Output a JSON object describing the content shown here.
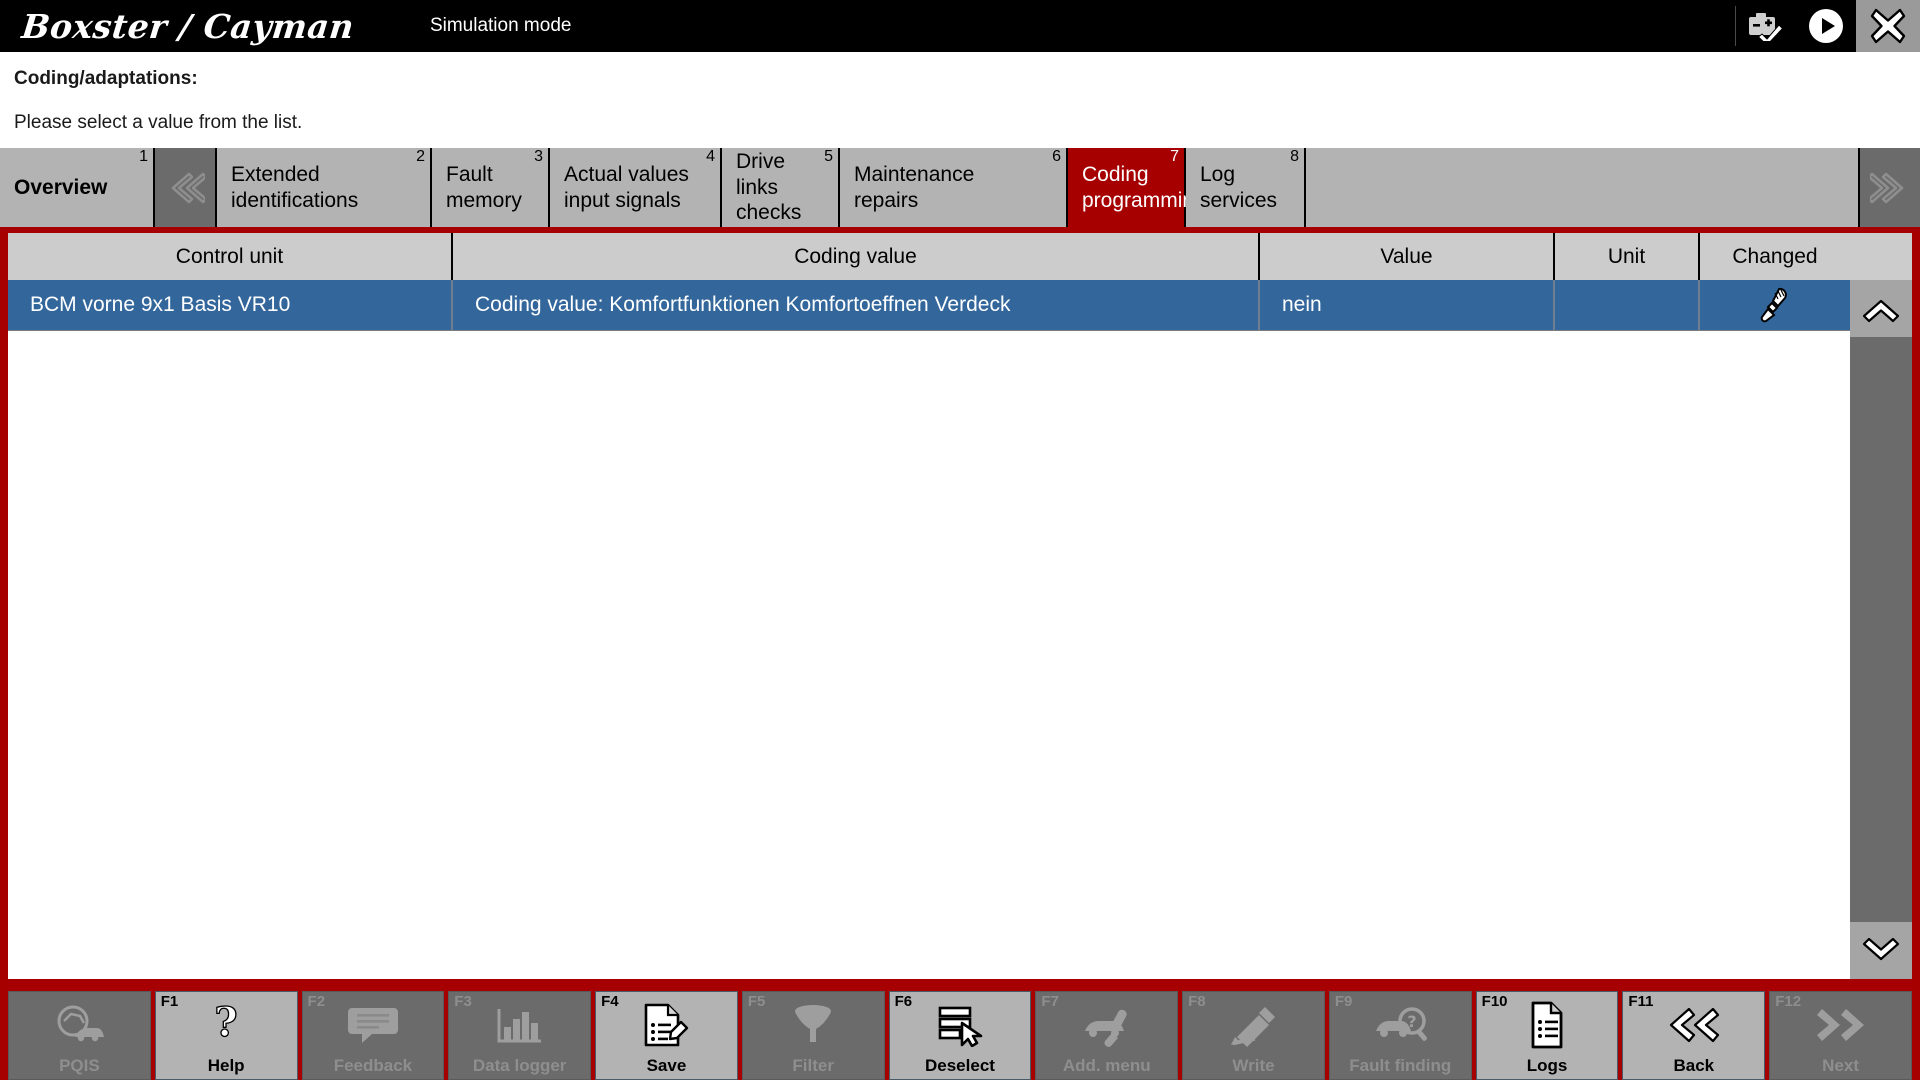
{
  "titlebar": {
    "brand": "Boxster / Cayman",
    "mode": "Simulation mode",
    "icons": [
      {
        "name": "battery-check-icon",
        "label": "Battery status OK"
      },
      {
        "name": "play-icon",
        "label": "Start"
      },
      {
        "name": "close-icon",
        "label": "Close"
      }
    ]
  },
  "header": {
    "title": "Coding/adaptations:",
    "instruction": "Please select a value from the list."
  },
  "tabs": {
    "prev_arrow": "chevron-left-icon",
    "next_arrow": "chevron-right-icon",
    "items": [
      {
        "num": "1",
        "label": "Overview",
        "active": false,
        "bold": true
      },
      {
        "num": "2",
        "label": "Extended\nidentifications",
        "active": false,
        "bold": false
      },
      {
        "num": "3",
        "label": "Fault memory",
        "active": false,
        "bold": false
      },
      {
        "num": "4",
        "label": "Actual values\ninput signals",
        "active": false,
        "bold": false
      },
      {
        "num": "5",
        "label": "Drive links\nchecks",
        "active": false,
        "bold": false
      },
      {
        "num": "6",
        "label": "Maintenance\nrepairs",
        "active": false,
        "bold": false
      },
      {
        "num": "7",
        "label": "Coding\nprogramming",
        "active": true,
        "bold": false
      },
      {
        "num": "8",
        "label": "Log services",
        "active": false,
        "bold": false
      }
    ]
  },
  "table": {
    "columns": [
      {
        "key": "control_unit",
        "label": "Control unit"
      },
      {
        "key": "coding_value",
        "label": "Coding value"
      },
      {
        "key": "value",
        "label": "Value"
      },
      {
        "key": "unit",
        "label": "Unit"
      },
      {
        "key": "changed",
        "label": "Changed"
      }
    ],
    "rows": [
      {
        "selected": true,
        "control_unit": "BCM vorne 9x1 Basis VR10",
        "coding_value": "Coding value: Komfortfunktionen Komfortoeffnen Verdeck",
        "value": "nein",
        "unit": "",
        "changed_icon": "screwdriver-icon"
      }
    ]
  },
  "scrollbar": {
    "up_icon": "chevron-up-icon",
    "down_icon": "chevron-down-icon"
  },
  "function_bar": [
    {
      "fkey": "",
      "label": "PQIS",
      "icon": "pqis-icon",
      "enabled": false
    },
    {
      "fkey": "F1",
      "label": "Help",
      "icon": "question-mark-icon",
      "enabled": true
    },
    {
      "fkey": "F2",
      "label": "Feedback",
      "icon": "speech-bubble-icon",
      "enabled": false
    },
    {
      "fkey": "F3",
      "label": "Data logger",
      "icon": "bar-chart-icon",
      "enabled": false
    },
    {
      "fkey": "F4",
      "label": "Save",
      "icon": "save-document-icon",
      "enabled": true
    },
    {
      "fkey": "F5",
      "label": "Filter",
      "icon": "funnel-icon",
      "enabled": false
    },
    {
      "fkey": "F6",
      "label": "Deselect",
      "icon": "deselect-icon",
      "enabled": true
    },
    {
      "fkey": "F7",
      "label": "Add. menu",
      "icon": "car-tool-icon",
      "enabled": false
    },
    {
      "fkey": "F8",
      "label": "Write",
      "icon": "write-icon",
      "enabled": false
    },
    {
      "fkey": "F9",
      "label": "Fault finding",
      "icon": "car-search-icon",
      "enabled": false
    },
    {
      "fkey": "F10",
      "label": "Logs",
      "icon": "document-list-icon",
      "enabled": true
    },
    {
      "fkey": "F11",
      "label": "Back",
      "icon": "double-chevron-left-icon",
      "enabled": true
    },
    {
      "fkey": "F12",
      "label": "Next",
      "icon": "double-chevron-right-icon",
      "enabled": false
    }
  ],
  "colors": {
    "accent_red": "#a60000",
    "selection_blue": "#33679c",
    "tab_gray": "#b3b3b3",
    "header_gray": "#cccccc",
    "disabled_gray": "#6b6b6b"
  }
}
